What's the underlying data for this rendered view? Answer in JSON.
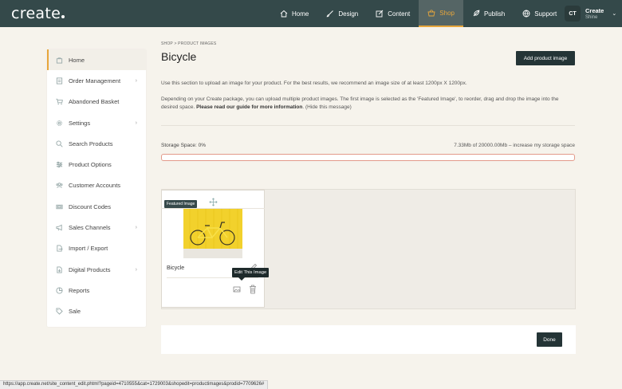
{
  "brand": {
    "logo": "create"
  },
  "nav": {
    "items": [
      {
        "label": "Home",
        "icon": "home-icon"
      },
      {
        "label": "Design",
        "icon": "brush-icon"
      },
      {
        "label": "Content",
        "icon": "edit-icon"
      },
      {
        "label": "Shop",
        "icon": "basket-icon"
      },
      {
        "label": "Publish",
        "icon": "rocket-icon"
      },
      {
        "label": "Support",
        "icon": "globe-icon"
      }
    ],
    "active": "Shop"
  },
  "user": {
    "initials": "CT",
    "name": "Create",
    "subtitle": "Shine"
  },
  "sidebar": {
    "items": [
      {
        "label": "Home",
        "icon": "bag-icon"
      },
      {
        "label": "Order Management",
        "icon": "orders-icon"
      },
      {
        "label": "Abandoned Basket",
        "icon": "cart-icon"
      },
      {
        "label": "Settings",
        "icon": "gear-icon"
      },
      {
        "label": "Search Products",
        "icon": "search-icon"
      },
      {
        "label": "Product Options",
        "icon": "sliders-icon"
      },
      {
        "label": "Customer Accounts",
        "icon": "users-icon"
      },
      {
        "label": "Discount Codes",
        "icon": "ticket-icon"
      },
      {
        "label": "Sales Channels",
        "icon": "megaphone-icon"
      },
      {
        "label": "Import / Export",
        "icon": "import-icon"
      },
      {
        "label": "Digital Products",
        "icon": "download-icon"
      },
      {
        "label": "Reports",
        "icon": "chart-icon"
      },
      {
        "label": "Sale",
        "icon": "tag-icon"
      }
    ]
  },
  "page": {
    "breadcrumb": "SHOP > PRODUCT IMAGES",
    "title": "Bicycle",
    "add_button": "Add product image",
    "intro": "Use this section to upload an image for your product. For the best results, we recommend an image size of at least 1200px X 1200px.",
    "info_text": "Depending on your Create package, you can upload multiple product images. The first image is selected as the 'Featured Image', to reorder, drag and drop the image into the desired space.",
    "info_link": "Please read our guide for more information",
    "hide_link": "(Hide this message)",
    "storage_label": "Storage Space: 0%",
    "storage_detail": "7.33Mb of 20000.00Mb – increase my storage space",
    "storage_used_pct": 0,
    "featured_badge": "Featured Image",
    "image_name": "Bicycle",
    "tooltip": "Edit This Image",
    "done_button": "Done"
  },
  "status_url": "https://app.create.net/site_content_edit.phtml?pageid=4710555&cat=1729003&shopedit=productimages&prodid=7709626#",
  "colors": {
    "nav_bg": "#34494a",
    "accent": "#e7a63c",
    "button_bg": "#243436",
    "page_bg": "#f6f3ec"
  }
}
